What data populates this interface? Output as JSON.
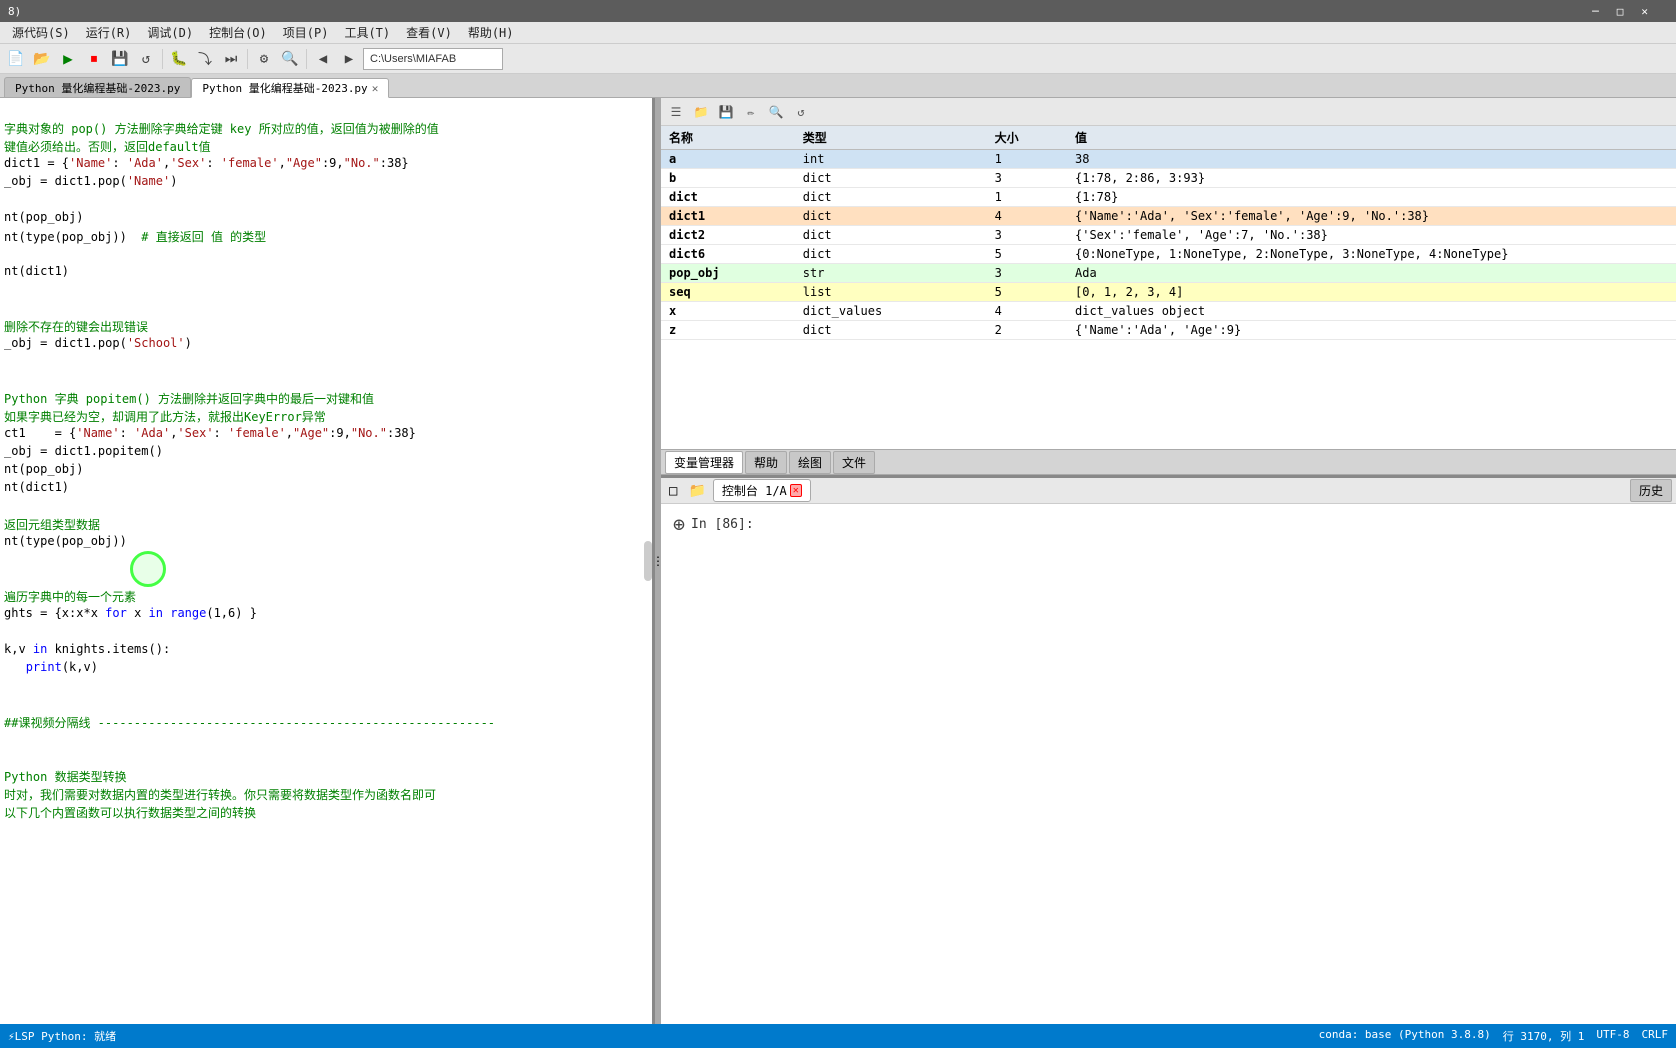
{
  "titlebar": {
    "text": "8)"
  },
  "menubar": {
    "items": [
      "源代码(S)",
      "运行(R)",
      "调试(D)",
      "控制台(O)",
      "项目(P)",
      "工具(T)",
      "查看(V)",
      "帮助(H)"
    ]
  },
  "toolbar": {
    "path": "C:\\Users\\MIAFAB"
  },
  "tabs": [
    {
      "label": "Python 量化编程基础-2023.py",
      "active": false,
      "closable": false
    },
    {
      "label": "Python 量化编程基础-2023.py",
      "active": true,
      "closable": true
    }
  ],
  "code": {
    "lines": [
      {
        "ln": "",
        "text": ""
      },
      {
        "ln": "",
        "text": "字典对象的 pop() 方法删除字典给定键 key 所对应的值，返回值为被删除的值",
        "comment": true
      },
      {
        "ln": "",
        "text": "键值必须给出。否则，返回default值",
        "comment": true
      },
      {
        "ln": "",
        "text": "dict1 = {'Name': 'Ada','Sex': 'female',\"Age\":9,\"No.\":38}"
      },
      {
        "ln": "",
        "text": "_obj = dict1.pop('Name')"
      },
      {
        "ln": "",
        "text": ""
      },
      {
        "ln": "",
        "text": "nt(pop_obj)"
      },
      {
        "ln": "",
        "text": "nt(type(pop_obj))  # 直接返回 值 的类型",
        "hasComment": true
      },
      {
        "ln": "",
        "text": ""
      },
      {
        "ln": "",
        "text": "nt(dict1)"
      },
      {
        "ln": "",
        "text": ""
      },
      {
        "ln": "",
        "text": ""
      },
      {
        "ln": "",
        "text": "删除不存在的键会出现错误",
        "comment": true
      },
      {
        "ln": "",
        "text": "_obj = dict1.pop('School')"
      },
      {
        "ln": "",
        "text": ""
      },
      {
        "ln": "",
        "text": ""
      },
      {
        "ln": "",
        "text": "Python 字典 popitem() 方法删除并返回字典中的最后一对键和值",
        "comment": true
      },
      {
        "ln": "",
        "text": "如果字典已经为空，却调用了此方法，就报出KeyError异常",
        "comment": true
      },
      {
        "ln": "",
        "text": "ct1    = {'Name': 'Ada','Sex': 'female',\"Age\":9,\"No.\":38}"
      },
      {
        "ln": "",
        "text": "_obj = dict1.popitem()"
      },
      {
        "ln": "",
        "text": "nt(pop_obj)"
      },
      {
        "ln": "",
        "text": "nt(dict1)"
      },
      {
        "ln": "",
        "text": ""
      },
      {
        "ln": "",
        "text": "返回元组类型数据",
        "comment": true
      },
      {
        "ln": "",
        "text": "nt(type(pop_obj))"
      },
      {
        "ln": "",
        "text": ""
      },
      {
        "ln": "",
        "text": ""
      },
      {
        "ln": "",
        "text": "遍历字典中的每一个元素",
        "comment": true
      },
      {
        "ln": "",
        "text": "ghts = {x:x*x for x in range(1,6) }"
      },
      {
        "ln": "",
        "text": ""
      },
      {
        "ln": "",
        "text": "k,v in knights.items():"
      },
      {
        "ln": "",
        "text": "   print(k,v)"
      },
      {
        "ln": "",
        "text": ""
      },
      {
        "ln": "",
        "text": ""
      },
      {
        "ln": "",
        "text": "##课视频分隔线 -------------------------------------------------------",
        "comment": true
      },
      {
        "ln": "",
        "text": ""
      },
      {
        "ln": "",
        "text": ""
      },
      {
        "ln": "",
        "text": "Python 数据类型转换",
        "comment": true
      },
      {
        "ln": "",
        "text": "时对，我们需要对数据内置的类型进行转换。你只需要将数据类型作为函数名即可",
        "comment": true
      },
      {
        "ln": "",
        "text": "以下几个内置函数可以执行数据类型之间的转换",
        "comment": true
      }
    ]
  },
  "var_manager": {
    "title": "变量管理器",
    "columns": [
      "名称",
      "类型",
      "大小",
      "值"
    ],
    "rows": [
      {
        "name": "a",
        "type": "int",
        "size": "1",
        "value": "38",
        "style": "selected"
      },
      {
        "name": "b",
        "type": "dict",
        "size": "3",
        "value": "{1:78, 2:86, 3:93}",
        "style": "normal"
      },
      {
        "name": "dict",
        "type": "dict",
        "size": "1",
        "value": "{1:78}",
        "style": "normal"
      },
      {
        "name": "dict1",
        "type": "dict",
        "size": "4",
        "value": "{'Name':'Ada', 'Sex':'female', 'Age':9, 'No.':38}",
        "style": "highlight"
      },
      {
        "name": "dict2",
        "type": "dict",
        "size": "3",
        "value": "{'Sex':'female', 'Age':7, 'No.':38}",
        "style": "normal"
      },
      {
        "name": "dict6",
        "type": "dict",
        "size": "5",
        "value": "{0:NoneType, 1:NoneType, 2:NoneType, 3:NoneType, 4:NoneType}",
        "style": "normal"
      },
      {
        "name": "pop_obj",
        "type": "str",
        "size": "3",
        "value": "Ada",
        "style": "green"
      },
      {
        "name": "seq",
        "type": "list",
        "size": "5",
        "value": "[0, 1, 2, 3, 4]",
        "style": "yellow"
      },
      {
        "name": "x",
        "type": "dict_values",
        "size": "4",
        "value": "dict_values object",
        "style": "normal"
      },
      {
        "name": "z",
        "type": "dict",
        "size": "2",
        "value": "{'Name':'Ada', 'Age':9}",
        "style": "normal"
      }
    ]
  },
  "bottom_tabs": {
    "var_tabs": [
      "变量管理器",
      "帮助",
      "绘图",
      "文件"
    ]
  },
  "console": {
    "prompt": "In [86]:",
    "content": ""
  },
  "console_tabs": {
    "label": "控制台 1/A",
    "history": "历史"
  },
  "statusbar": {
    "left": [
      "⚡LSP Python: 就绪"
    ],
    "right": [
      "conda: base (Python 3.8.8)",
      "行 3170, 列 1",
      "UTF-8",
      "CRLF"
    ]
  }
}
